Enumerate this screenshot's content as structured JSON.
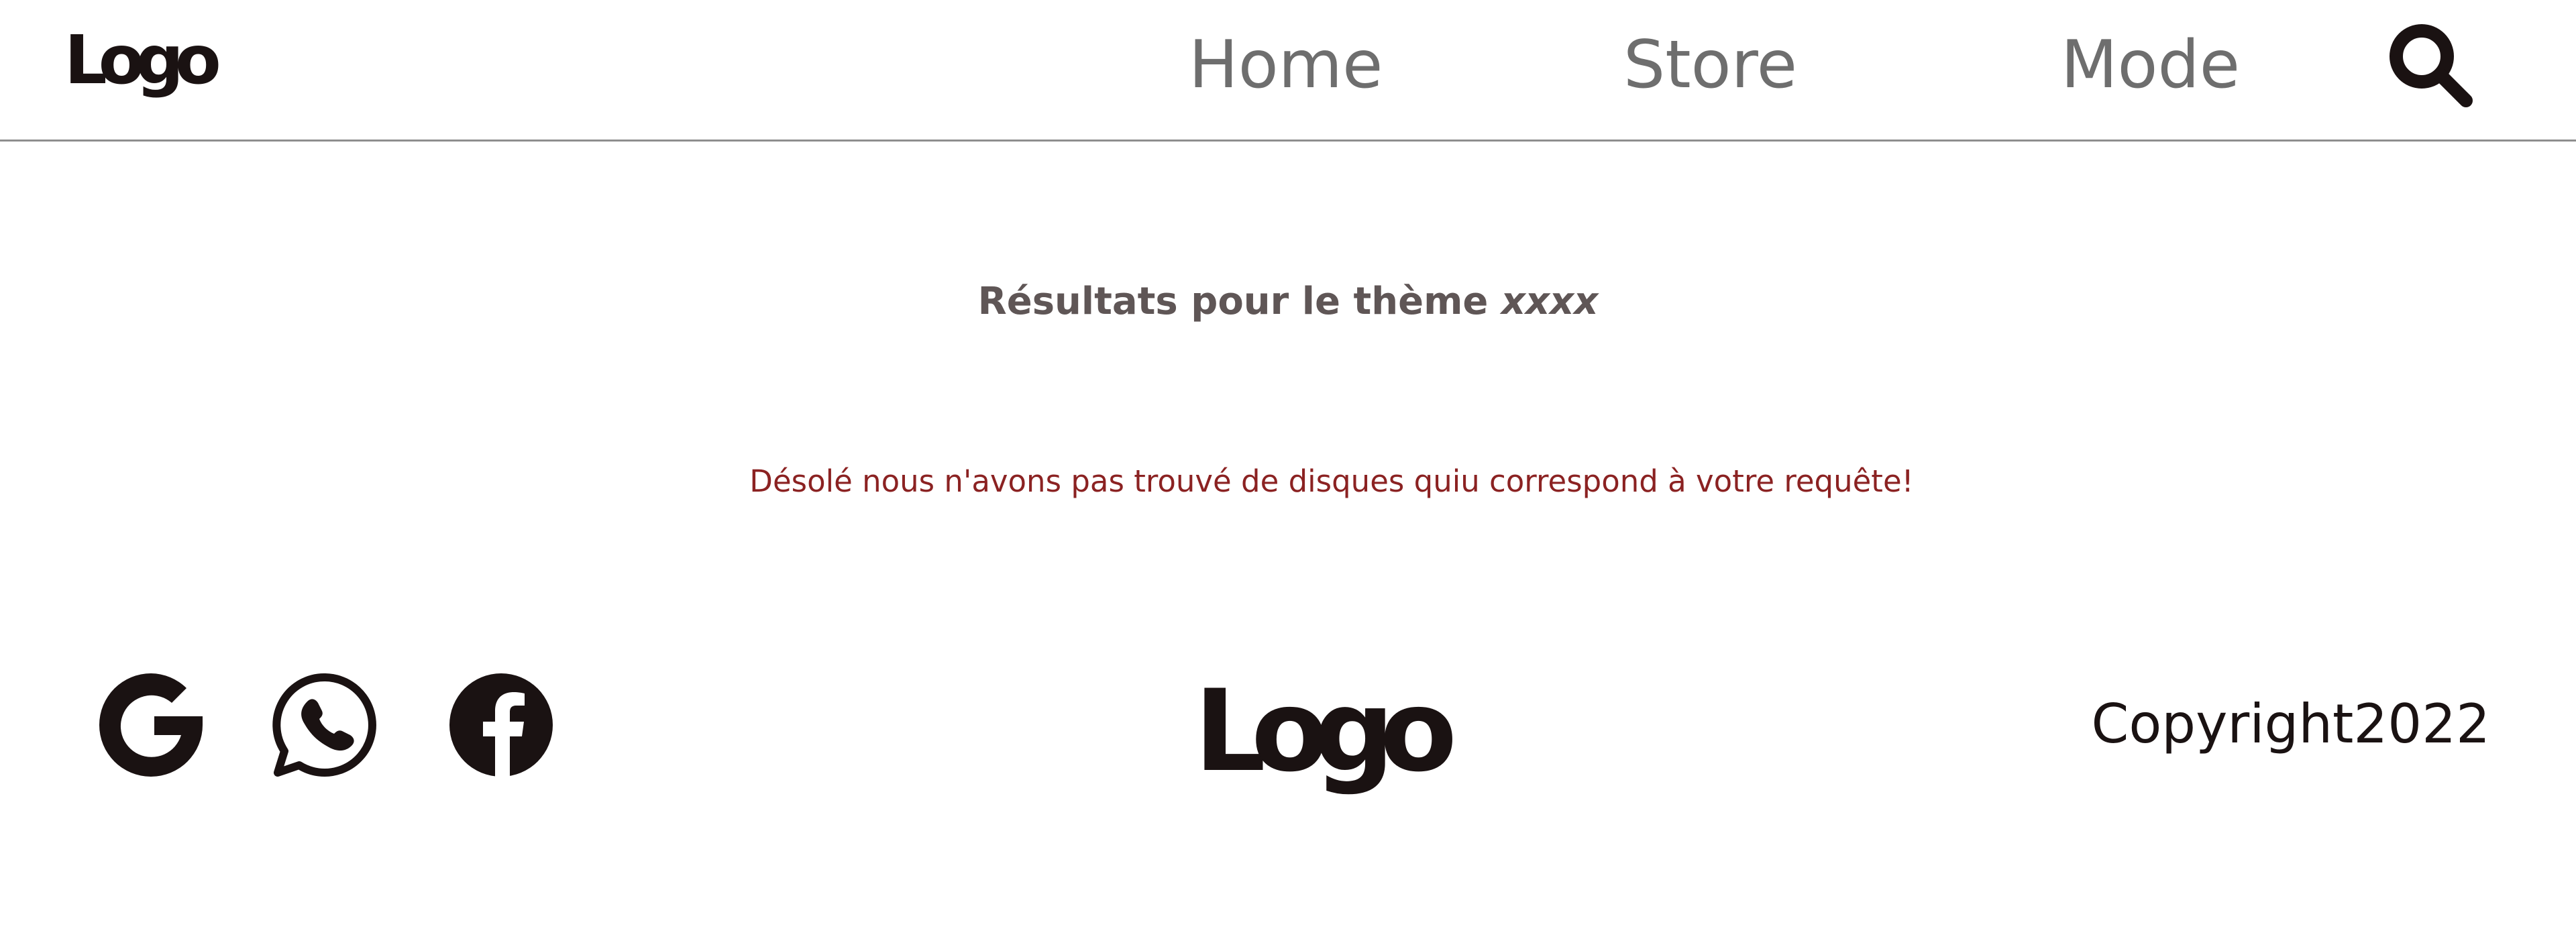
{
  "colors": {
    "text_dark": "#1a1212",
    "nav_text": "#6e6e6e",
    "heading": "#5f5656",
    "error": "#8b2222",
    "divider": "#8e8e8e",
    "background": "#ffffff"
  },
  "header": {
    "logo_text": "Logo",
    "nav": [
      {
        "label": "Home"
      },
      {
        "label": "Store"
      },
      {
        "label": "Mode"
      }
    ],
    "search_icon": "search-icon"
  },
  "main": {
    "title_prefix": "Résultats pour le thème",
    "theme": "xxxx",
    "empty_message": "Désolé nous n'avons pas trouvé de disques quiu correspond à votre requête!"
  },
  "footer": {
    "social": [
      {
        "icon": "google-icon"
      },
      {
        "icon": "whatsapp-icon"
      },
      {
        "icon": "facebook-icon"
      }
    ],
    "logo_text": "Logo",
    "copyright": "Copyright2022"
  }
}
